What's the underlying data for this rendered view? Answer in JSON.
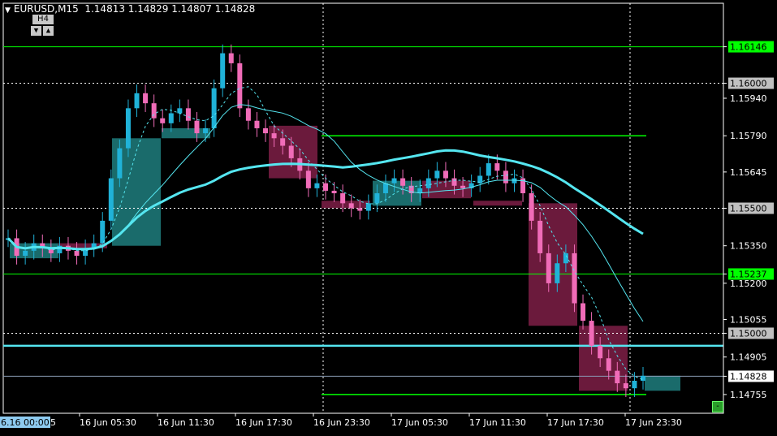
{
  "header": {
    "symbol": "EURUSD,M15",
    "ohlc": "1.14813 1.14829 1.14807 1.14828",
    "timeframe_button": "H4",
    "down_glyph": "▼",
    "up_glyph": "▲"
  },
  "colors": {
    "background": "#000000",
    "bull_candle": "#20b2d8",
    "bear_candle": "#f06cb8",
    "bull_box": "#1a6b6b",
    "bear_box": "#6b1a3c",
    "green_level": "#00ff00",
    "ma_line": "#55e6f0",
    "label_gray": "#c0c0c0",
    "label_green": "#00ff00"
  },
  "price_axis": {
    "ticks": [
      "1.16146",
      "1.16000",
      "1.15940",
      "1.15790",
      "1.15645",
      "1.15500",
      "1.15350",
      "1.15237",
      "1.15200",
      "1.15055",
      "1.15000",
      "1.14905",
      "1.14828",
      "1.14755"
    ],
    "highlighted": {
      "1.16146": "green",
      "1.16000": "gray",
      "1.15500": "gray",
      "1.15237": "green",
      "1.15000": "gray",
      "1.14828": "white"
    }
  },
  "time_axis": {
    "ticks": [
      "6.16 00:00",
      "16 Jun 05:30",
      "16 Jun 11:30",
      "16 Jun 17:30",
      "16 Jun 23:30",
      "17 Jun 05:30",
      "17 Jun 11:30",
      "17 Jun 17:30",
      "17 Jun 23:30"
    ],
    "clipped_tick": "5"
  },
  "chart_data": {
    "type": "candlestick",
    "symbol": "EURUSD",
    "timeframe": "M15",
    "ylim": [
      1.1468,
      1.1632
    ],
    "current_price": 1.14828,
    "horizontal_levels": [
      1.16146,
      1.15237,
      1.1495
    ],
    "dotted_levels": [
      1.16,
      1.155,
      1.15
    ],
    "short_levels": [
      1.1579,
      1.14755
    ],
    "h4_boxes": [
      {
        "open": 1.153,
        "close": 1.1536,
        "dir": "bull"
      },
      {
        "open": 1.1536,
        "close": 1.1534,
        "dir": "bear"
      },
      {
        "open": 1.1535,
        "close": 1.1578,
        "dir": "bull"
      },
      {
        "open": 1.1578,
        "close": 1.1582,
        "dir": "bull"
      },
      {
        "open": 1.1583,
        "close": 1.1562,
        "dir": "bear"
      },
      {
        "open": 1.1553,
        "close": 1.155,
        "dir": "bear"
      },
      {
        "open": 1.1551,
        "close": 1.1561,
        "dir": "bull"
      },
      {
        "open": 1.1561,
        "close": 1.1554,
        "dir": "bear"
      },
      {
        "open": 1.1553,
        "close": 1.1552,
        "dir": "bear"
      },
      {
        "open": 1.1552,
        "close": 1.1503,
        "dir": "bear"
      },
      {
        "open": 1.1503,
        "close": 1.1477,
        "dir": "bear"
      },
      {
        "open": 1.1477,
        "close": 1.1483,
        "dir": "bull"
      }
    ],
    "candles_close": [
      1.1538,
      1.1531,
      1.1533,
      1.1536,
      1.1534,
      1.1532,
      1.1535,
      1.1533,
      1.1531,
      1.1534,
      1.1536,
      1.1545,
      1.1562,
      1.1574,
      1.159,
      1.1596,
      1.1592,
      1.1586,
      1.1584,
      1.1588,
      1.159,
      1.1585,
      1.158,
      1.1582,
      1.1598,
      1.1612,
      1.1608,
      1.159,
      1.1585,
      1.1582,
      1.158,
      1.1578,
      1.1575,
      1.157,
      1.1565,
      1.1558,
      1.156,
      1.1557,
      1.1556,
      1.1552,
      1.155,
      1.1549,
      1.1552,
      1.1556,
      1.156,
      1.1562,
      1.1559,
      1.1556,
      1.1558,
      1.1562,
      1.1565,
      1.1562,
      1.1559,
      1.1558,
      1.156,
      1.1563,
      1.1568,
      1.1565,
      1.156,
      1.1562,
      1.1556,
      1.1545,
      1.1532,
      1.152,
      1.1528,
      1.1532,
      1.1512,
      1.1505,
      1.1495,
      1.149,
      1.1485,
      1.148,
      1.1478,
      1.1481,
      1.1483
    ]
  }
}
